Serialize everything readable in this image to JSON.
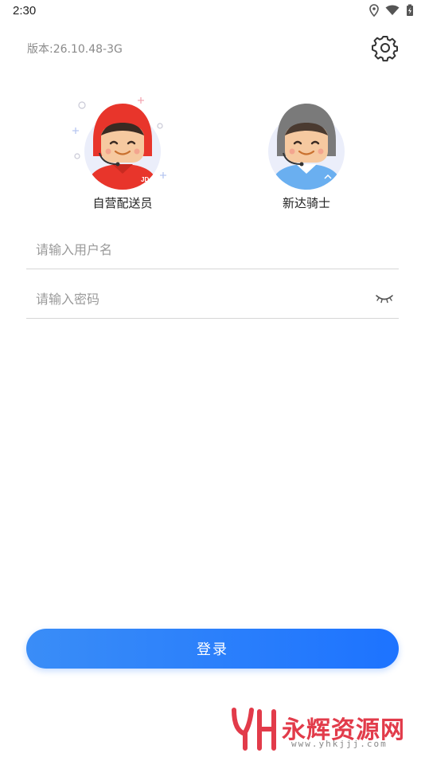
{
  "status_bar": {
    "time": "2:30",
    "icons": [
      "location-icon",
      "wifi-icon",
      "battery-charging-icon"
    ]
  },
  "header": {
    "version": "版本:26.10.48-3G",
    "settings_icon": "gear-icon"
  },
  "roles": [
    {
      "label": "自营配送员",
      "icon": "red-helmet-courier-avatar",
      "badge": "JD",
      "color": "#e8352b"
    },
    {
      "label": "新达骑士",
      "icon": "gray-helmet-rider-avatar",
      "color": "#7a7a7a"
    }
  ],
  "form": {
    "username_placeholder": "请输入用户名",
    "password_placeholder": "请输入密码",
    "password_toggle_icon": "eye-closed-icon"
  },
  "login_button": {
    "label": "登录",
    "color": "#1d73ff"
  },
  "watermark": {
    "name": "永辉资源网",
    "url": "www.yhkjjj.com",
    "color": "#e23b4a"
  }
}
